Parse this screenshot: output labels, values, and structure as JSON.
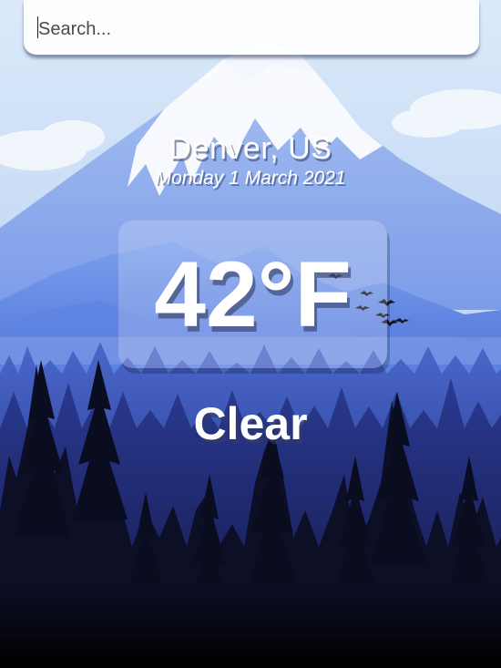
{
  "search": {
    "placeholder": "Search...",
    "value": ""
  },
  "location": {
    "city_country": "Denver, US",
    "date": "Monday 1 March 2021"
  },
  "weather": {
    "temperature": "42°F",
    "condition": "Clear"
  },
  "background": {
    "description_icon": "mountain-forest-landscape",
    "colors": {
      "sky": "#c6dcf4",
      "snow": "#ffffff",
      "mountain_far": "#8aaef0",
      "mountain_mid": "#5a82e0",
      "forest_far": "#3a55b8",
      "forest_mid": "#22307a",
      "forest_near": "#0d1030"
    }
  }
}
